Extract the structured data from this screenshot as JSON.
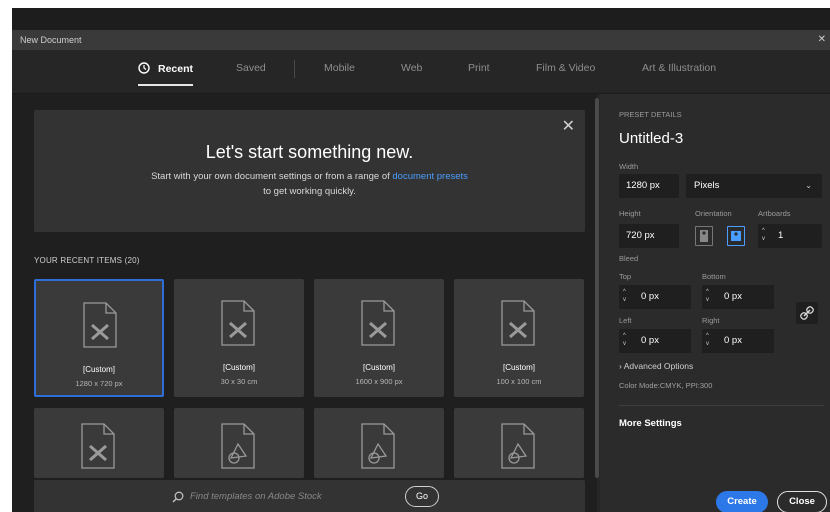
{
  "window": {
    "title": "New Document"
  },
  "tabs": [
    {
      "label": "Recent",
      "active": true
    },
    {
      "label": "Saved"
    },
    {
      "label": "Mobile"
    },
    {
      "label": "Web"
    },
    {
      "label": "Print"
    },
    {
      "label": "Film & Video"
    },
    {
      "label": "Art & Illustration"
    }
  ],
  "hero": {
    "heading": "Let's start something new.",
    "line1_prefix": "Start with your own document settings or from a range of ",
    "line1_link": "document presets",
    "line2": "to get working quickly."
  },
  "recent": {
    "label": "YOUR RECENT ITEMS",
    "count": "(20)"
  },
  "cards": [
    {
      "name": "[Custom]",
      "size": "1280 x 720 px",
      "selected": true
    },
    {
      "name": "[Custom]",
      "size": "30 x 30 cm"
    },
    {
      "name": "[Custom]",
      "size": "1600 x 900 px"
    },
    {
      "name": "[Custom]",
      "size": "100 x 100 cm"
    }
  ],
  "search": {
    "placeholder": "Find templates on Adobe Stock",
    "go_label": "Go"
  },
  "preset": {
    "section_label": "PRESET DETAILS",
    "doc_title": "Untitled-3",
    "width_label": "Width",
    "width_value": "1280 px",
    "unit_value": "Pixels",
    "height_label": "Height",
    "height_value": "720 px",
    "orientation_label": "Orientation",
    "artboards_label": "Artboards",
    "artboards_value": "1",
    "bleed_label": "Bleed",
    "top_label": "Top",
    "top_value": "0 px",
    "bottom_label": "Bottom",
    "bottom_value": "0 px",
    "left_label": "Left",
    "left_value": "0 px",
    "right_label": "Right",
    "right_value": "0 px",
    "advanced_label": "Advanced Options",
    "color_mode": "Color Mode:CMYK, PPI:300",
    "more_settings": "More Settings"
  },
  "buttons": {
    "create": "Create",
    "close": "Close"
  },
  "colors": {
    "accent": "#2d78e8",
    "link": "#4a9eff"
  }
}
